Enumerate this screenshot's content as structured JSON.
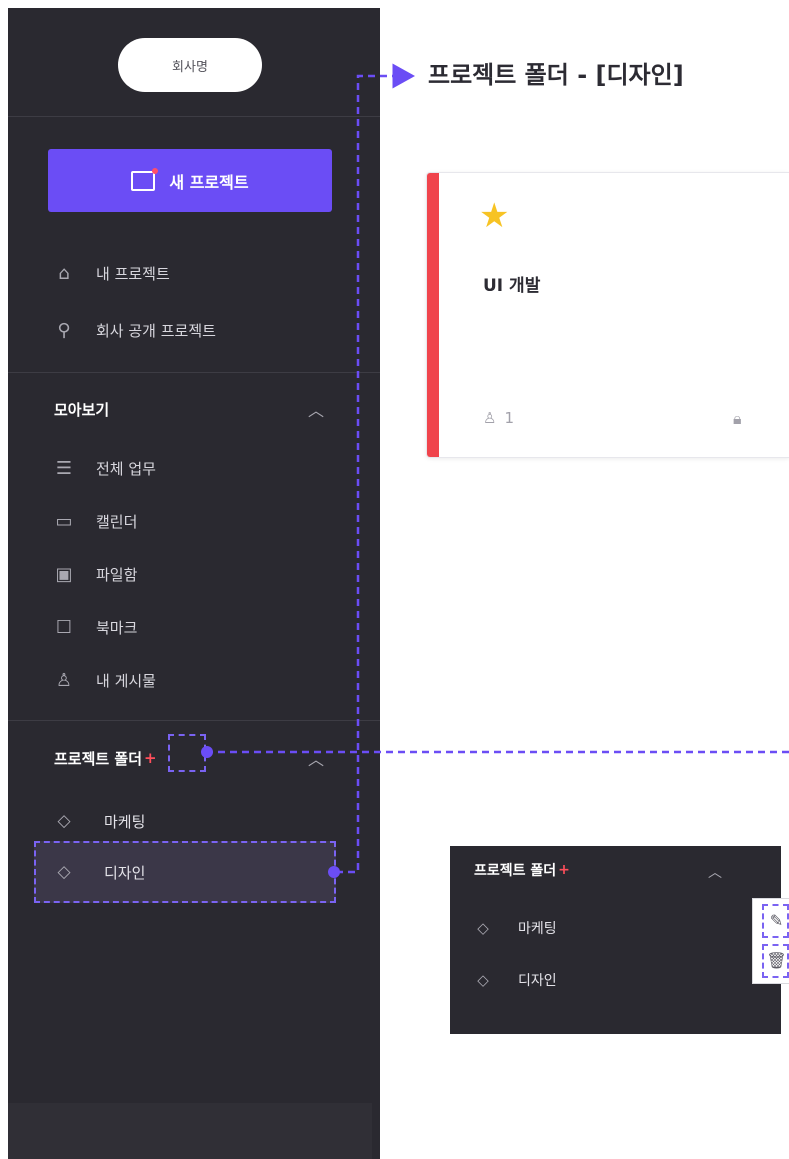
{
  "sidebar": {
    "company_name": "회사명",
    "new_project_label": "새 프로젝트",
    "nav": {
      "my_projects": "내 프로젝트",
      "public_projects": "회사 공개 프로젝트"
    },
    "collection": {
      "title": "모아보기",
      "items": [
        "전체 업무",
        "캘린더",
        "파일함",
        "북마크",
        "내 게시물"
      ]
    },
    "folders": {
      "title": "프로젝트 폴더",
      "plus": "+",
      "items": [
        "마케팅",
        "디자인"
      ]
    }
  },
  "main": {
    "title": "프로젝트 폴더 - [디자인]",
    "card": {
      "title": "UI 개발",
      "member_count": "1",
      "accent_color": "#f0444c",
      "starred": true
    }
  },
  "popup": {
    "title": "프로젝트 폴더",
    "plus": "+",
    "items": [
      "마케팅",
      "디자인"
    ],
    "tools": [
      "edit-icon",
      "trash-icon"
    ]
  },
  "colors": {
    "sidebar_bg": "#2a2930",
    "accent": "#6b4df5",
    "highlight_dash": "#7a63f2",
    "danger": "#ff4e5b"
  }
}
